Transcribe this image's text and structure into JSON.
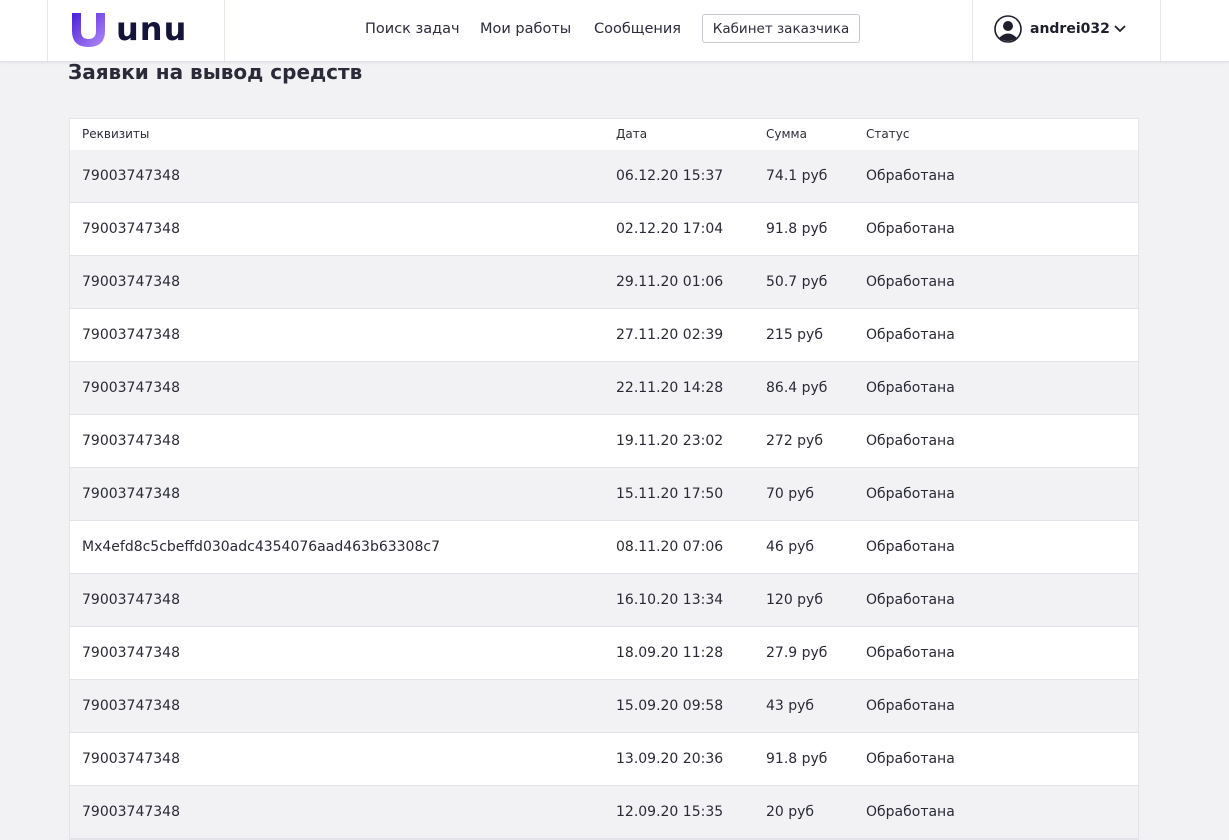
{
  "header": {
    "logo_text": "unu",
    "nav": {
      "search_tasks": "Поиск задач",
      "my_works": "Мои работы",
      "messages": "Сообщения"
    },
    "customer_cabinet": "Кабинет заказчика",
    "user": {
      "username": "andrei032"
    }
  },
  "page": {
    "title": "Заявки на вывод средств"
  },
  "table": {
    "columns": [
      "Реквизиты",
      "Дата",
      "Сумма",
      "Статус"
    ],
    "rows": [
      {
        "requisites": "79003747348",
        "date": "06.12.20 15:37",
        "amount": "74.1 руб",
        "status": "Обработана"
      },
      {
        "requisites": "79003747348",
        "date": "02.12.20 17:04",
        "amount": "91.8 руб",
        "status": "Обработана"
      },
      {
        "requisites": "79003747348",
        "date": "29.11.20 01:06",
        "amount": "50.7 руб",
        "status": "Обработана"
      },
      {
        "requisites": "79003747348",
        "date": "27.11.20 02:39",
        "amount": "215 руб",
        "status": "Обработана"
      },
      {
        "requisites": "79003747348",
        "date": "22.11.20 14:28",
        "amount": "86.4 руб",
        "status": "Обработана"
      },
      {
        "requisites": "79003747348",
        "date": "19.11.20 23:02",
        "amount": "272 руб",
        "status": "Обработана"
      },
      {
        "requisites": "79003747348",
        "date": "15.11.20 17:50",
        "amount": "70 руб",
        "status": "Обработана"
      },
      {
        "requisites": "Mx4efd8c5cbeffd030adc4354076aad463b63308c7",
        "date": "08.11.20 07:06",
        "amount": "46 руб",
        "status": "Обработана"
      },
      {
        "requisites": "79003747348",
        "date": "16.10.20 13:34",
        "amount": "120 руб",
        "status": "Обработана"
      },
      {
        "requisites": "79003747348",
        "date": "18.09.20 11:28",
        "amount": "27.9 руб",
        "status": "Обработана"
      },
      {
        "requisites": "79003747348",
        "date": "15.09.20 09:58",
        "amount": "43 руб",
        "status": "Обработана"
      },
      {
        "requisites": "79003747348",
        "date": "13.09.20 20:36",
        "amount": "91.8 руб",
        "status": "Обработана"
      },
      {
        "requisites": "79003747348",
        "date": "12.09.20 15:35",
        "amount": "20 руб",
        "status": "Обработана"
      }
    ]
  },
  "colors": {
    "brand_gradient_start": "#5b2be0",
    "brand_gradient_end": "#a87cf5",
    "logo_text": "#14143a",
    "row_alt": "#f2f2f5",
    "page_bg": "#f2f2f5"
  },
  "icons": {
    "logo": "unu-logo-icon",
    "avatar": "user-avatar-icon",
    "dropdown": "chevron-down-icon"
  }
}
